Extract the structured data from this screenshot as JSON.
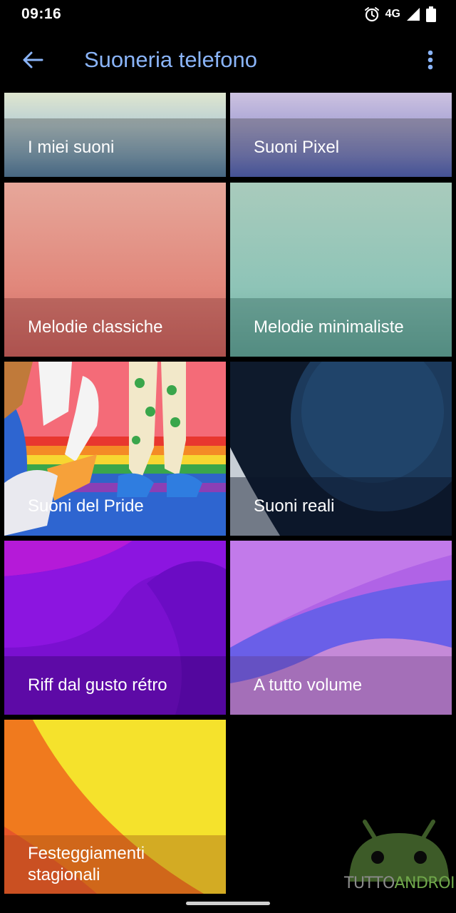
{
  "status_bar": {
    "time": "09:16",
    "network": "4G",
    "icons": [
      "alarm-icon",
      "signal-icon",
      "battery-icon"
    ]
  },
  "app_bar": {
    "title": "Suoneria telefono",
    "back_icon": "arrow-back-icon",
    "menu_icon": "more-vert-icon",
    "title_color": "#8ab4f8"
  },
  "categories": [
    {
      "label": "I miei suoni"
    },
    {
      "label": "Suoni Pixel"
    },
    {
      "label": "Melodie classiche"
    },
    {
      "label": "Melodie minimaliste"
    },
    {
      "label": "Suoni del Pride"
    },
    {
      "label": "Suoni reali"
    },
    {
      "label": "Riff dal gusto rétro"
    },
    {
      "label": "A tutto volume"
    },
    {
      "label": "Festeggiamenti stagionali"
    }
  ],
  "watermark": {
    "part1": "TUTTO",
    "part2": "ANDROID"
  }
}
